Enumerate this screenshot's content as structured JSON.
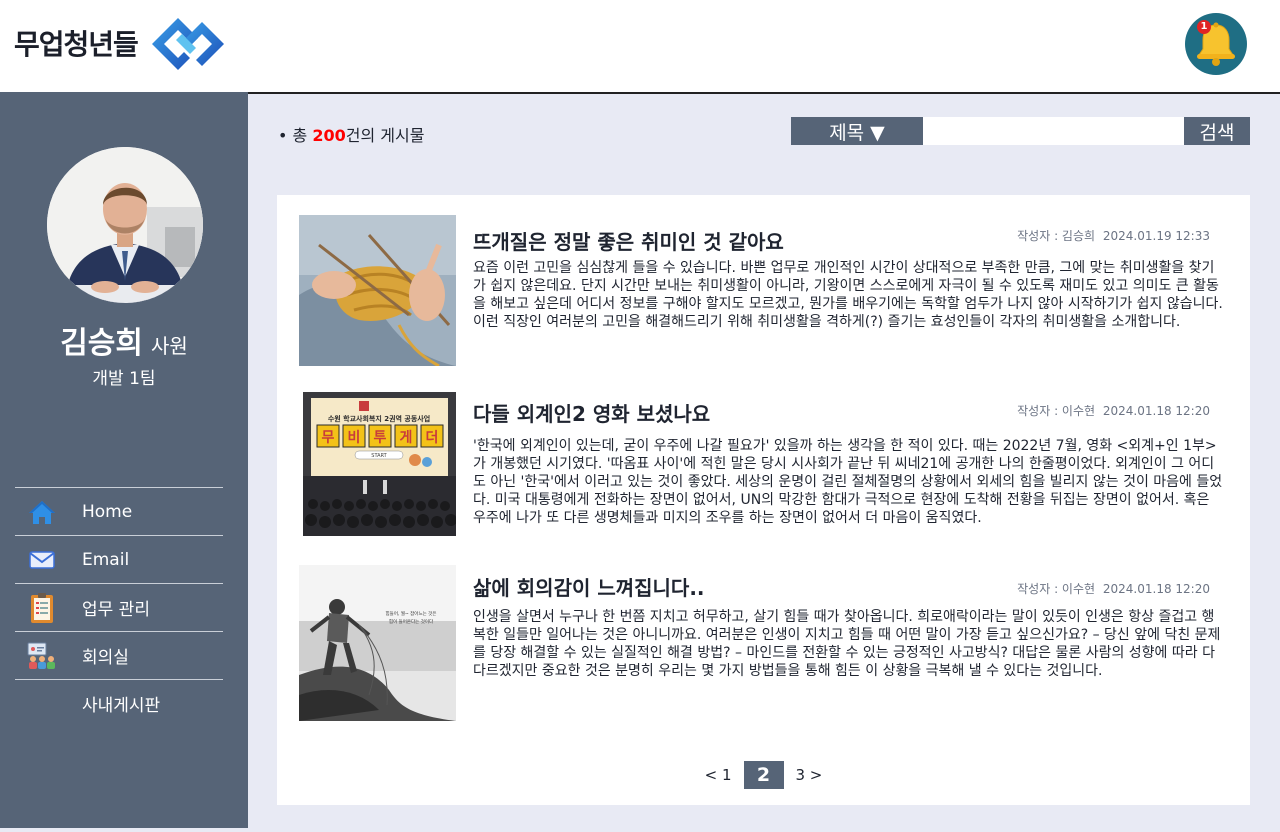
{
  "header": {
    "logo_text": "무업청년들",
    "notification_count": "1",
    "accent": "#1f6e84"
  },
  "sidebar": {
    "user_name": "김승희",
    "user_rank": "사원",
    "user_team": "개발 1팀",
    "items": [
      {
        "label": "Home",
        "icon": "home-icon"
      },
      {
        "label": "Email",
        "icon": "mail-icon"
      },
      {
        "label": "업무 관리",
        "icon": "clipboard-icon"
      },
      {
        "label": "회의실",
        "icon": "meeting-icon"
      },
      {
        "label": "사내게시판",
        "icon": ""
      }
    ]
  },
  "board": {
    "total_prefix": "• 총 ",
    "total_count": "200",
    "total_suffix": "건의 게시물",
    "search_field": "제목 ▼",
    "search_value": "",
    "search_button": "검색",
    "posts": [
      {
        "title": "뜨개질은 정말 좋은 취미인 것 같아요",
        "author": "작성자 : 김승희",
        "date": "2024.01.19 12:33",
        "body": "요즘 이런 고민을 심심찮게 들을 수 있습니다. 바쁜 업무로 개인적인 시간이 상대적으로 부족한 만큼, 그에 맞는 취미생활을 찾기가 쉽지 않은데요. 단지 시간만 보내는 취미생활이 아니라, 기왕이면 스스로에게 자극이 될 수 있도록 재미도 있고 의미도 큰 활동을 해보고 싶은데 어디서 정보를 구해야 할지도 모르겠고, 뭔가를 배우기에는 독학할 엄두가 나지 않아 시작하기가 쉽지 않습니다. 이런 직장인 여러분의 고민을 해결해드리기 위해 취미생활을 격하게(?) 즐기는 효성인들이 각자의 취미생활을 소개합니다."
      },
      {
        "title": "다들 외계인2 영화 보셨나요",
        "author": "작성자 : 이수현",
        "date": "2024.01.18 12:20",
        "body": "'한국에 외계인이 있는데, 굳이 우주에 나갈 필요가' 있을까 하는 생각을 한 적이 있다. 때는 2022년 7월, 영화 <외계+인 1부>가 개봉했던 시기였다. '따옴표 사이'에 적힌 말은 당시 시사회가 끝난 뒤 씨네21에 공개한 나의 한줄평이었다. 외계인이 그 어디도 아닌 '한국'에서 이러고 있는 것이 좋았다. 세상의 운명이 걸린 절체절명의 상황에서 외세의 힘을 빌리지 않는 것이 마음에 들었다. 미국 대통령에게 전화하는 장면이 없어서, UN의 막강한 함대가 극적으로 현장에 도착해 전황을 뒤집는 장면이 없어서. 혹은 우주에 나가 또 다른 생명체들과 미지의 조우를 하는 장면이 없어서 더 마음이 움직였다.",
        "poster_title": "수원 학교사회복지 2권역 공동사업",
        "poster_letters": [
          "무",
          "비",
          "투",
          "게",
          "더"
        ],
        "poster_start": "START"
      },
      {
        "title": "삶에 회의감이 느껴집니다..",
        "author": "작성자 : 이수현",
        "date": "2024.01.18 12:20",
        "body": "인생을 살면서 누구나 한 번쯤 지치고 허무하고, 살기 힘들 때가 찾아옵니다. 희로애락이라는 말이 있듯이 인생은 항상 즐겁고 행복한 일들만 일어나는 것은 아니니까요. 여러분은 인생이 지치고 힘들 때 어떤 말이 가장 듣고 싶으신가요? – 당신 앞에 닥친 문제를 당장 해결할 수 있는 실질적인 해결 방법? – 마인드를 전환할 수 있는 긍정적인 사고방식? 대답은 물론 사람의 성향에 따라 다 다르겠지만 중요한 것은 분명히 우리는 몇 가지 방법들을 통해 힘든 이 상황을 극복해 낼 수 있다는 것입니다.",
        "photo_caption_1": "힘들어, 뭘~ 잡아느는 것은",
        "photo_caption_2": "힘이 들어온다는 것이다"
      }
    ],
    "pagination": {
      "prev": "< 1",
      "current": "2",
      "next": "3 >"
    }
  }
}
